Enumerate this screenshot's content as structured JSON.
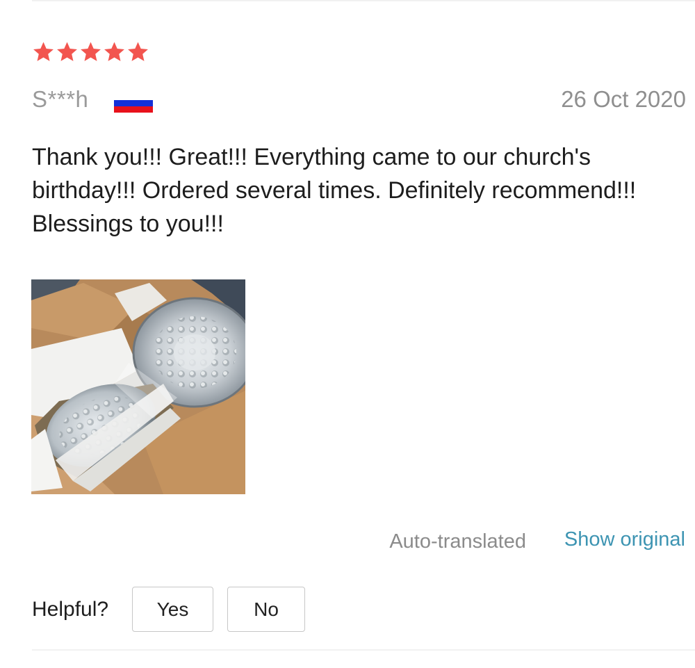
{
  "review": {
    "rating": 5,
    "rating_max": 5,
    "star_color": "#f2554f",
    "reviewer": "S***h",
    "country_flag": "russia-flag-icon",
    "flag_colors": [
      "#ffffff",
      "#1530d8",
      "#e8111b"
    ],
    "date": "26 Oct 2020",
    "text": "Thank you!!! Great!!! Everything came to our church's birthday!!! Ordered several times. Definitely recommend!!! Blessings to you!!!",
    "photo_count": 1
  },
  "translation": {
    "status": "Auto-translated",
    "show_original_label": "Show original",
    "link_color": "#3d94b2"
  },
  "helpful": {
    "label": "Helpful?",
    "yes_label": "Yes",
    "no_label": "No"
  }
}
